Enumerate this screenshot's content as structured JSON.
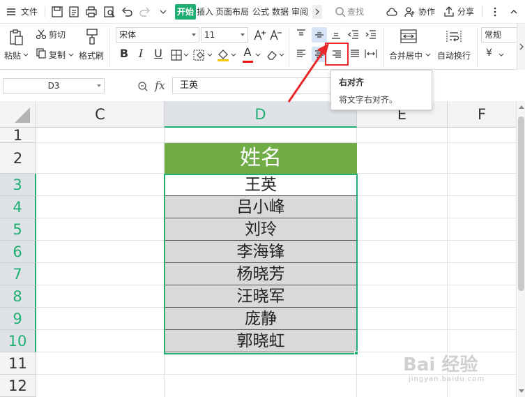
{
  "menubar": {
    "file_label": "文件",
    "tabs": [
      "开始",
      "插入",
      "页面布局",
      "公式",
      "数据",
      "审阅"
    ],
    "active_tab": "开始",
    "search_label": "查找",
    "collab_label": "协作",
    "share_label": "分享"
  },
  "ribbon": {
    "paste_label": "粘贴",
    "cut_label": "剪切",
    "copy_label": "复制",
    "format_painter_label": "格式刷",
    "font_name": "宋体",
    "font_size": "11",
    "bold": "B",
    "italic": "I",
    "underline": "U",
    "font_color_letter": "A",
    "merge_center_label": "合并居中",
    "wrap_text_label": "自动换行",
    "number_format": "常规",
    "currency_symbol": "¥"
  },
  "tooltip": {
    "title": "右对齐",
    "description": "将文字右对齐。"
  },
  "formula_bar": {
    "cell_ref": "D3",
    "fx": "fx",
    "value": "王英"
  },
  "sheet": {
    "columns": [
      "C",
      "D",
      "E",
      "F"
    ],
    "selected_column": "D",
    "rows": [
      "1",
      "2",
      "3",
      "4",
      "5",
      "6",
      "7",
      "8",
      "9",
      "10",
      "11",
      "12"
    ],
    "header_text": "姓名",
    "names": [
      "王英",
      "吕小峰",
      "刘玲",
      "李海锋",
      "杨晓芳",
      "汪晓军",
      "庞静",
      "郭晓虹"
    ],
    "header_fill": "#70ad47",
    "name_fill": "#d9d9d9",
    "selection_color": "#1fae72"
  },
  "watermark": {
    "text": "Bai 经验",
    "sub": "jingyan.baidu.com"
  }
}
